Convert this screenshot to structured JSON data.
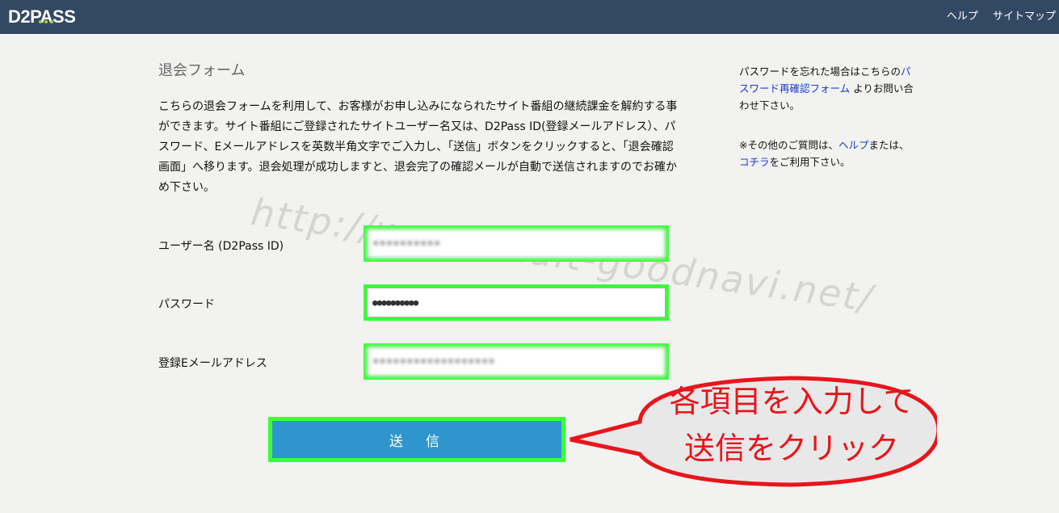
{
  "header": {
    "logo": "D2PASS",
    "nav": [
      "ヘルプ",
      "サイトマップ"
    ]
  },
  "form": {
    "title": "退会フォーム",
    "description": "こちらの退会フォームを利用して、お客様がお申し込みになられたサイト番組の継続課金を解約する事ができます。サイト番組にご登録されたサイトユーザー名又は、D2Pass ID(登録メールアドレス）、パスワード、Eメールアドレスを英数半角文字でご入力し、「送信」ボタンをクリックすると、「退会確認画面」へ移ります。退会処理が成功しますと、退会完了の確認メールが自動で送信されますのでお確かめ下さい。",
    "fields": [
      {
        "label": "ユーザー名 (D2Pass ID)",
        "value": "••••••••••"
      },
      {
        "label": "パスワード",
        "value": "●●●●●●●●●●"
      },
      {
        "label": "登録Eメールアドレス",
        "value": "••••••••••••••••••"
      }
    ],
    "submit_label": "送信"
  },
  "sidebar": {
    "p1_before": "パスワードを忘れた場合はこちらの",
    "p1_link": "パスワード再確認フォーム",
    "p1_after": " よりお問い合わせ下さい。",
    "p2_before": "※その他のご質問は、",
    "p2_link1": "ヘルプ",
    "p2_mid": "または、",
    "p2_link2": "コチラ",
    "p2_after": "をご利用下さい。"
  },
  "watermark": "http://www.adult-goodnavi.net/",
  "callout": {
    "line1": "各項目を入力して",
    "line2": "送信をクリック"
  },
  "colors": {
    "header_bg": "#334863",
    "highlight": "#3aff3a",
    "button": "#2e96cd",
    "callout_red": "#e8151b"
  }
}
